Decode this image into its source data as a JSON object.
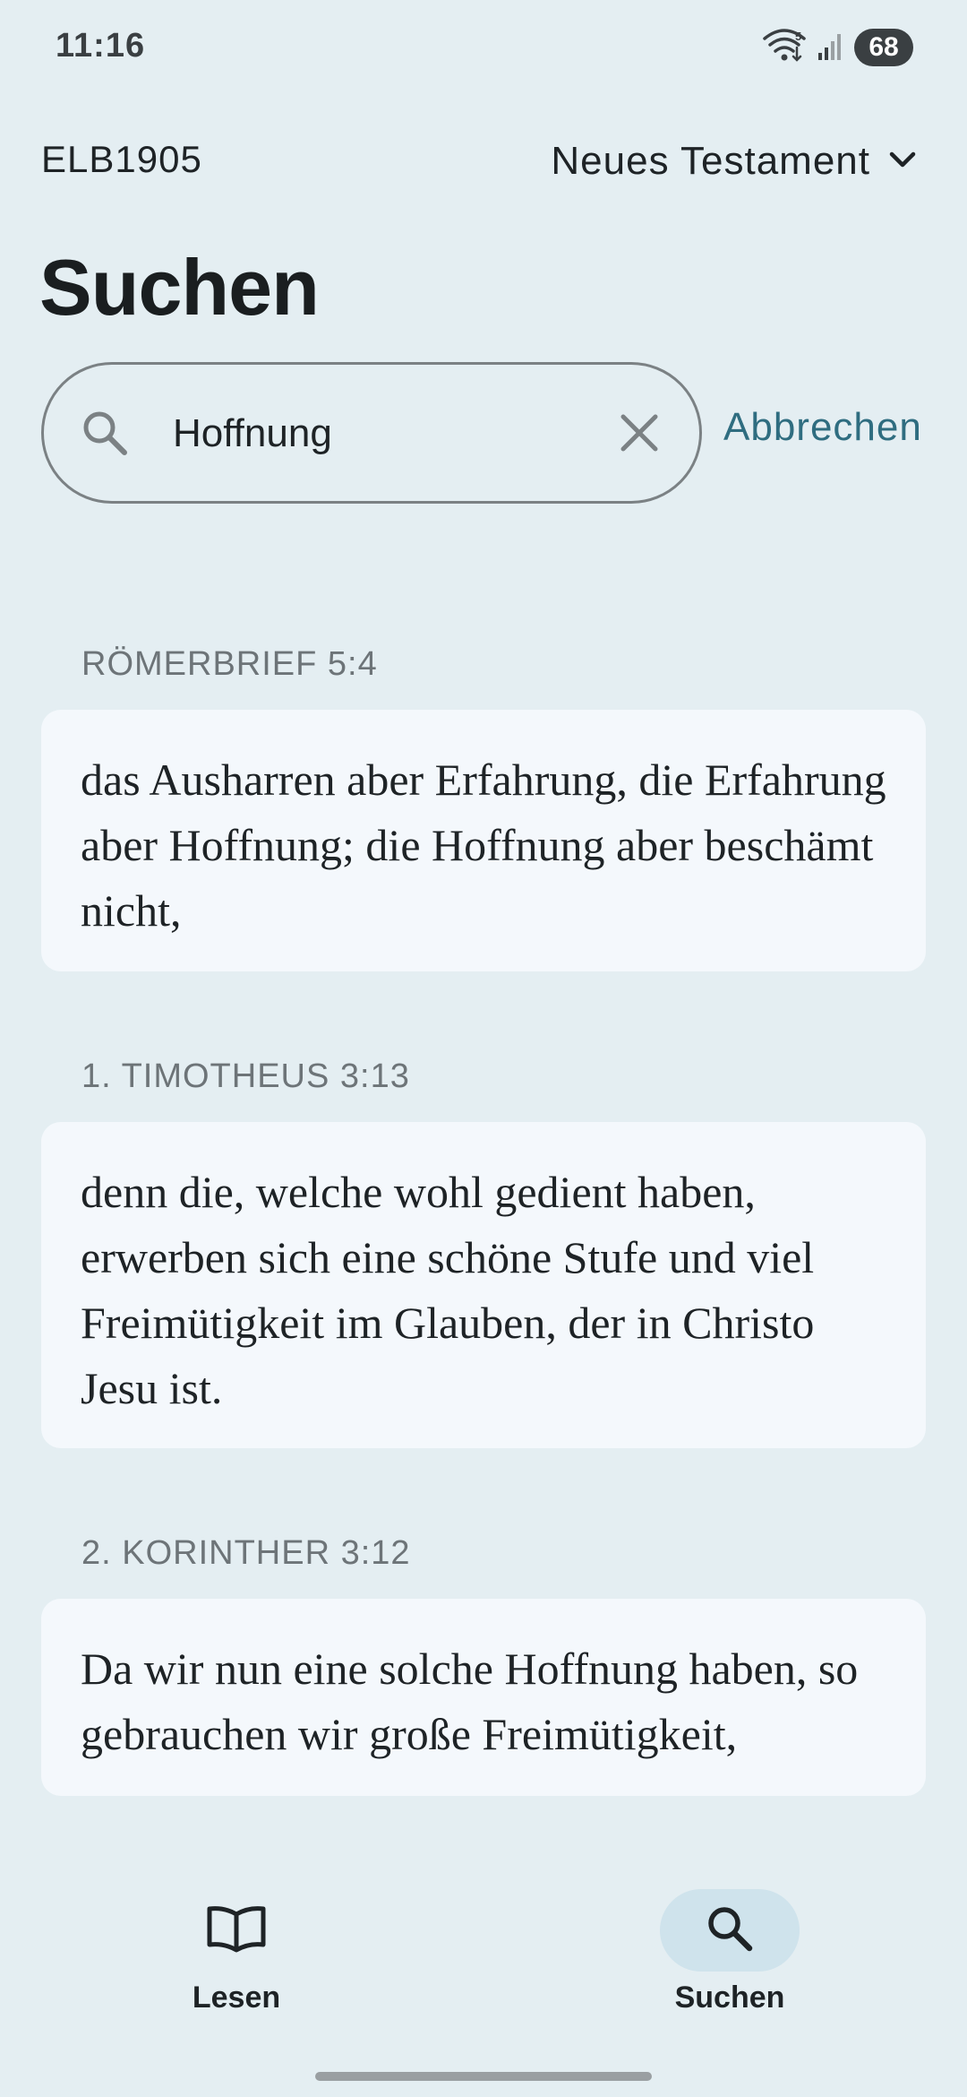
{
  "status_bar": {
    "time": "11:16",
    "battery": "68",
    "wifi_badge": "5"
  },
  "header": {
    "translation": "ELB1905",
    "testament": "Neues Testament"
  },
  "page": {
    "title": "Suchen"
  },
  "search": {
    "value": "Hoffnung",
    "cancel_label": "Abbrechen"
  },
  "results": [
    {
      "reference": "RÖMERBRIEF 5:4",
      "text": "das Ausharren aber Erfahrung, die Erfahrung aber Hoffnung; die Hoffnung aber beschämt nicht,"
    },
    {
      "reference": "1. TIMOTHEUS 3:13",
      "text": "denn die, welche wohl gedient haben, erwerben sich eine schöne Stufe und viel Freimütigkeit im Glauben, der in Christo Jesu ist."
    },
    {
      "reference": "2. KORINTHER 3:12",
      "text": "Da wir nun eine solche Hoffnung haben, so gebrauchen wir große Freimütigkeit,"
    }
  ],
  "bottom_nav": {
    "items": [
      {
        "label": "Lesen",
        "icon": "book-icon",
        "active": false
      },
      {
        "label": "Suchen",
        "icon": "search-icon",
        "active": true
      }
    ]
  },
  "colors": {
    "background": "#e4eef2",
    "card": "#f4f8fc",
    "accent": "#2f6d80",
    "active_nav": "#cfe3ec"
  }
}
